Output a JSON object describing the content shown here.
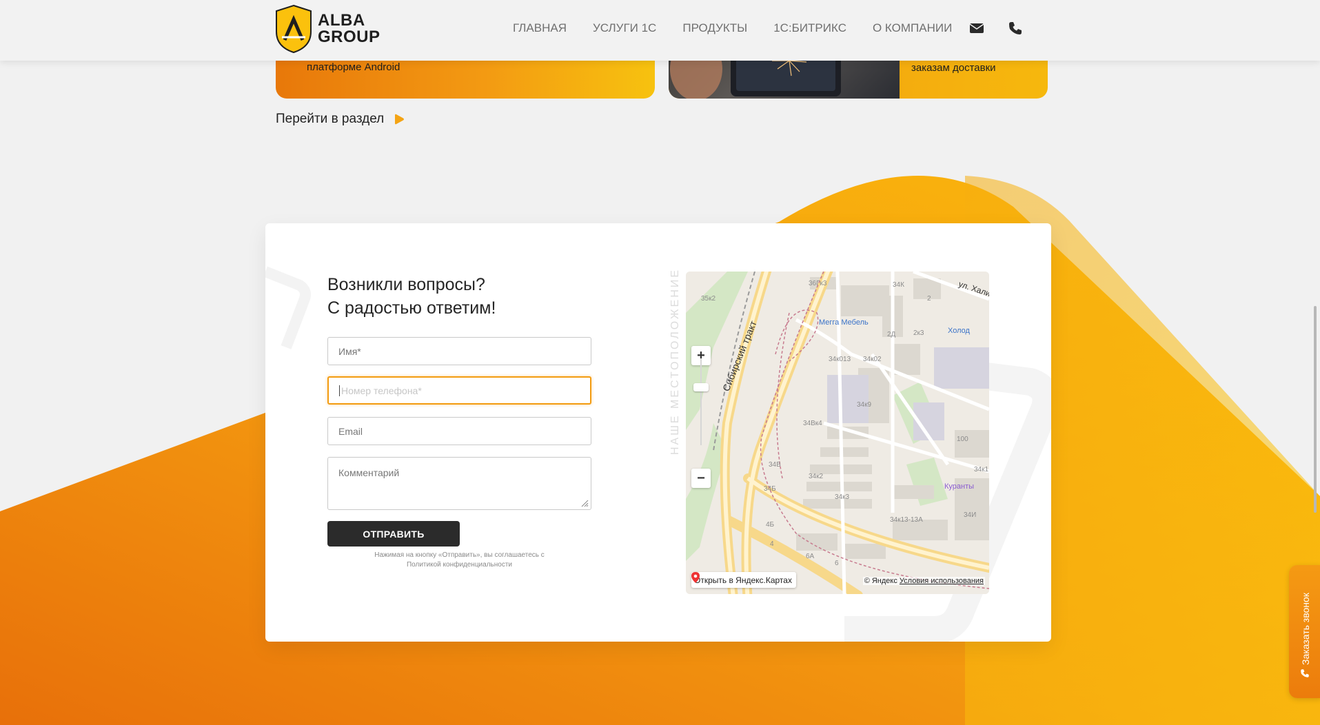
{
  "header": {
    "logo_line1": "ALBA",
    "logo_line2": "GROUP",
    "nav": [
      "ГЛАВНАЯ",
      "УСЛУГИ 1С",
      "ПРОДУКТЫ",
      "1С:БИТРИКС",
      "О КОМПАНИИ"
    ],
    "icons": [
      "mail-icon",
      "phone-icon"
    ]
  },
  "cards": {
    "card1_text": "платформе Android",
    "card2_text": "заказам доставки"
  },
  "goto_label": "Перейти в раздел",
  "form": {
    "title_line1": "Возникли вопросы?",
    "title_line2": "С радостью ответим!",
    "name_placeholder": "Имя*",
    "phone_placeholder": "Номер телефона*",
    "email_placeholder": "Email",
    "comment_placeholder": "Комментарий",
    "submit_label": "ОТПРАВИТЬ",
    "disclaimer_line1": "Нажимая на кнопку «Отправить», вы соглашаетесь с",
    "disclaimer_line2": "Политикой конфиденциальности"
  },
  "location_label": "НАШЕ МЕСТОПОЛОЖЕНИЕ",
  "map": {
    "street": "Сибирский тракт",
    "street2": "ул. Хали",
    "poi": [
      "Мегга Мебель",
      "Холод",
      "Куранты"
    ],
    "labels": [
      "35к2",
      "36Гк3",
      "34К",
      "2",
      "2Д",
      "2к3",
      "34к013",
      "34к02",
      "34к9",
      "34Вк4",
      "34В",
      "34к2",
      "34Б",
      "34к3",
      "100",
      "34к1",
      "34И",
      "34к13-13А",
      "4Б",
      "4",
      "6А",
      "6"
    ],
    "open_label": "Открыть в Яндекс.Картах",
    "copyright": "© Яндекс",
    "terms": "Условия использования"
  },
  "callback_label": "Заказать звонок",
  "colors": {
    "accent": "#f39c12",
    "orange_dark": "#e8700a",
    "yellow": "#fbc30d",
    "button": "#2b2b2b"
  }
}
